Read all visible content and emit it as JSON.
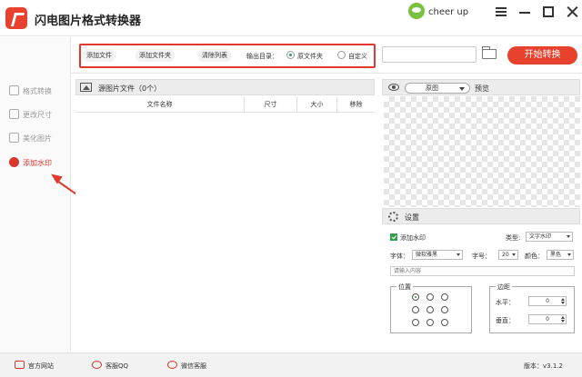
{
  "app": {
    "title": "闪电图片格式转换器",
    "user": "cheer up"
  },
  "sidebar": {
    "items": [
      {
        "label": "格式转换"
      },
      {
        "label": "更改尺寸"
      },
      {
        "label": "美化图片"
      },
      {
        "label": "添加水印",
        "active": true
      }
    ]
  },
  "toolbar": {
    "add_file": "添加文件",
    "add_folder": "添加文件夹",
    "clear_list": "清除列表",
    "output_dir_label": "输出目录：",
    "radio_original": "原文件夹",
    "radio_custom": "自定义",
    "path_value": "",
    "start": "开始转换"
  },
  "filepanel": {
    "title": "源图片文件（0个）",
    "columns": [
      "文件名称",
      "尺寸",
      "大小",
      "移除"
    ]
  },
  "preview": {
    "mode": "原图",
    "label": "预览"
  },
  "settings": {
    "title": "设置",
    "add_watermark": "添加水印",
    "type_label": "类型:",
    "type_value": "文字水印",
    "font_label": "字体：",
    "font_value": "微软雅黑",
    "size_label": "字号：",
    "size_value": "20",
    "color_label": "颜色：",
    "color_value": "黑色",
    "content_placeholder": "请输入内容",
    "position_title": "位置",
    "margin_title": "边距",
    "horizontal_label": "水平：",
    "horizontal_value": "0",
    "vertical_label": "垂直：",
    "vertical_value": "0"
  },
  "statusbar": {
    "website": "官方网站",
    "qq": "客服QQ",
    "wechat": "微信客服",
    "version": "版本：v3.1.2"
  },
  "colors": {
    "accent": "#e8412d",
    "annotation": "#e03a2f",
    "radio_on": "#31a04a"
  }
}
